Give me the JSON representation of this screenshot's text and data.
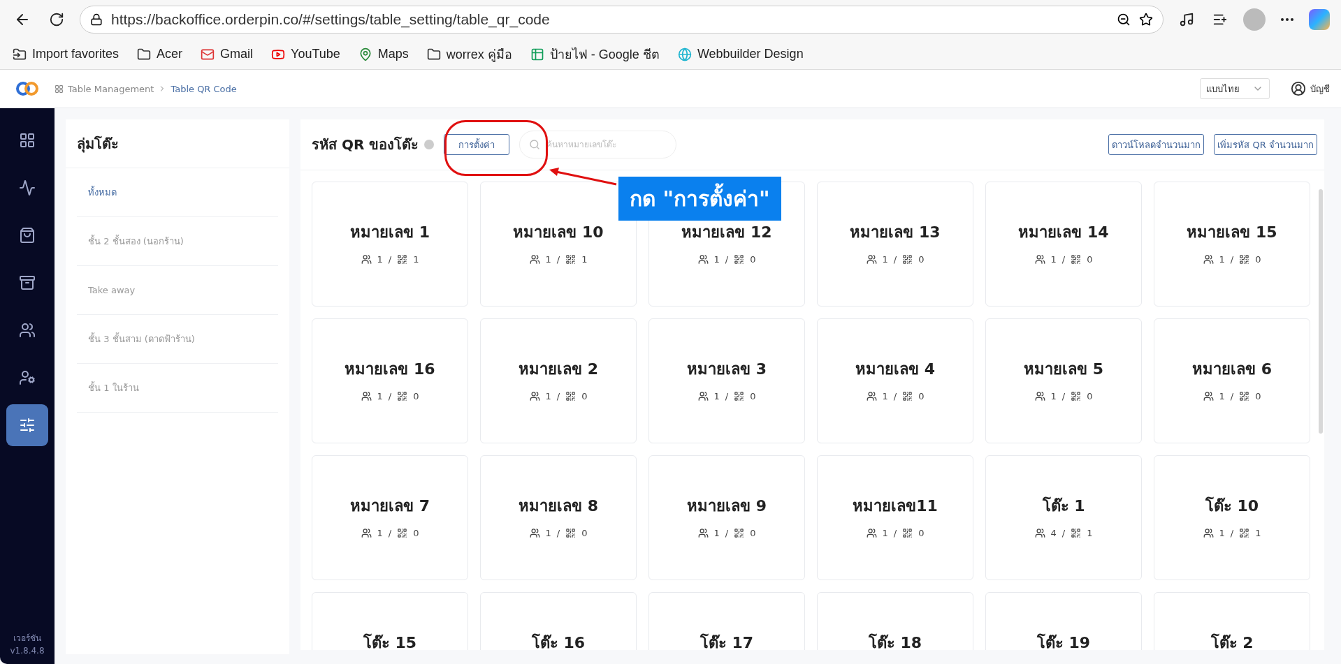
{
  "browser": {
    "url": "https://backoffice.orderpin.co/#/settings/table_setting/table_qr_code",
    "bookmarks": [
      {
        "label": "Import favorites",
        "kind": "import"
      },
      {
        "label": "Acer",
        "kind": "folder"
      },
      {
        "label": "Gmail",
        "kind": "mail"
      },
      {
        "label": "YouTube",
        "kind": "video"
      },
      {
        "label": "Maps",
        "kind": "map"
      },
      {
        "label": "worrex คู่มือ",
        "kind": "folder"
      },
      {
        "label": "ป้ายไฟ - Google ชีต",
        "kind": "sheet"
      },
      {
        "label": "Webbuilder Design",
        "kind": "web"
      }
    ]
  },
  "header": {
    "breadcrumb": [
      "Table Management",
      "Table QR Code"
    ],
    "language": "แบบไทย",
    "account": "บัญชี"
  },
  "nav": {
    "items": [
      {
        "kind": "grid",
        "selected": false
      },
      {
        "kind": "activity",
        "selected": false
      },
      {
        "kind": "bag",
        "selected": false
      },
      {
        "kind": "box",
        "selected": false
      },
      {
        "kind": "users",
        "selected": false
      },
      {
        "kind": "user-settings",
        "selected": false
      },
      {
        "kind": "sliders",
        "selected": true
      }
    ],
    "version_label": "เวอร์ชัน",
    "version": "v1.8.4.8"
  },
  "groups": {
    "title": "ลุ่มโต๊ะ",
    "items": [
      {
        "label": "ทั้งหมด",
        "selected": true
      },
      {
        "label": "ชั้น 2 ชั้นสอง (นอกร้าน)",
        "selected": false
      },
      {
        "label": "Take away",
        "selected": false
      },
      {
        "label": "ชั้น 3 ชั้นสาม (ดาดฟ้าร้าน)",
        "selected": false
      },
      {
        "label": "ชั้น 1 ในร้าน",
        "selected": false
      }
    ]
  },
  "main": {
    "title": "รหัส QR ของโต๊ะ",
    "settings_button": "การตั้งค่า",
    "search_placeholder": "ค้นหาหมายเลขโต๊ะ",
    "buttons": [
      "ดาวน์โหลดจำนวนมาก",
      "เพิ่มรหัส QR จำนวนมาก"
    ],
    "tables": [
      {
        "name": "หมายเลข 1",
        "guests": "1",
        "separator": "/",
        "qr": "1"
      },
      {
        "name": "หมายเลข 10",
        "guests": "1",
        "separator": "/",
        "qr": "1"
      },
      {
        "name": "หมายเลข 12",
        "guests": "1",
        "separator": "/",
        "qr": "0"
      },
      {
        "name": "หมายเลข 13",
        "guests": "1",
        "separator": "/",
        "qr": "0"
      },
      {
        "name": "หมายเลข 14",
        "guests": "1",
        "separator": "/",
        "qr": "0"
      },
      {
        "name": "หมายเลข 15",
        "guests": "1",
        "separator": "/",
        "qr": "0"
      },
      {
        "name": "หมายเลข 16",
        "guests": "1",
        "separator": "/",
        "qr": "0"
      },
      {
        "name": "หมายเลข 2",
        "guests": "1",
        "separator": "/",
        "qr": "0"
      },
      {
        "name": "หมายเลข 3",
        "guests": "1",
        "separator": "/",
        "qr": "0"
      },
      {
        "name": "หมายเลข 4",
        "guests": "1",
        "separator": "/",
        "qr": "0"
      },
      {
        "name": "หมายเลข 5",
        "guests": "1",
        "separator": "/",
        "qr": "0"
      },
      {
        "name": "หมายเลข 6",
        "guests": "1",
        "separator": "/",
        "qr": "0"
      },
      {
        "name": "หมายเลข 7",
        "guests": "1",
        "separator": "/",
        "qr": "0"
      },
      {
        "name": "หมายเลข 8",
        "guests": "1",
        "separator": "/",
        "qr": "0"
      },
      {
        "name": "หมายเลข 9",
        "guests": "1",
        "separator": "/",
        "qr": "0"
      },
      {
        "name": "หมายเลข11",
        "guests": "1",
        "separator": "/",
        "qr": "0"
      },
      {
        "name": "โต๊ะ 1",
        "guests": "4",
        "separator": "/",
        "qr": "1"
      },
      {
        "name": "โต๊ะ 10",
        "guests": "1",
        "separator": "/",
        "qr": "1"
      },
      {
        "name": "โต๊ะ 15"
      },
      {
        "name": "โต๊ะ 16"
      },
      {
        "name": "โต๊ะ 17"
      },
      {
        "name": "โต๊ะ 18"
      },
      {
        "name": "โต๊ะ 19"
      },
      {
        "name": "โต๊ะ 2"
      }
    ]
  },
  "annotation": {
    "callout": "กด \"การตั้งค่า\""
  }
}
